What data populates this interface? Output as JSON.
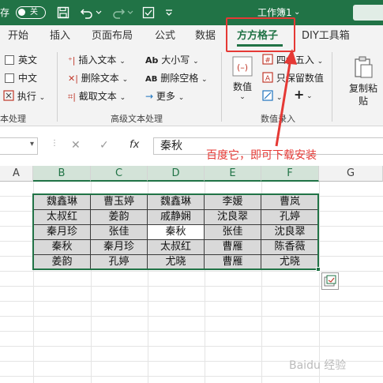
{
  "titlebar": {
    "autosave_label": "存",
    "toggle_label": "关",
    "title": "工作簿1",
    "title_arrow": "⌄"
  },
  "tabs": [
    {
      "label": "开始"
    },
    {
      "label": "插入"
    },
    {
      "label": "页面布局"
    },
    {
      "label": "公式"
    },
    {
      "label": "数据"
    },
    {
      "label": "方方格子",
      "active": true
    },
    {
      "label": "DIY工具箱"
    }
  ],
  "ribbon": {
    "text_group": {
      "items": [
        "英文",
        "中文",
        "执行"
      ],
      "label": "本处理"
    },
    "adv_text": {
      "col1": [
        "插入文本",
        "删除文本",
        "截取文本"
      ],
      "col2": [
        "大小写",
        "删除空格",
        "更多"
      ],
      "col2_icons": [
        "Ab",
        "AB",
        "→"
      ],
      "label": "高级文本处理"
    },
    "numeric": {
      "big_button": "数值",
      "items": [
        "四舍五入",
        "只保留数值"
      ],
      "label": "数值录入"
    },
    "copy": {
      "label_line1": "复制粘",
      "label_line2": "贴"
    }
  },
  "formula_bar": {
    "cancel": "✕",
    "confirm": "✓",
    "fx": "fx",
    "value": "秦秋"
  },
  "columns": [
    "A",
    "B",
    "C",
    "D",
    "E",
    "F",
    "G"
  ],
  "table": [
    [
      "魏鑫琳",
      "曹玉婷",
      "魏鑫琳",
      "李媛",
      "曹岚"
    ],
    [
      "太叔红",
      "姜韵",
      "戚静娴",
      "沈良翠",
      "孔婷"
    ],
    [
      "秦月珍",
      "张佳",
      "秦秋",
      "张佳",
      "沈良翠"
    ],
    [
      "秦秋",
      "秦月珍",
      "太叔红",
      "曹雁",
      "陈香薇"
    ],
    [
      "姜韵",
      "孔婷",
      "尤晓",
      "曹雁",
      "尤晓"
    ]
  ],
  "annotation": {
    "text": "百度它，即可下载安装"
  },
  "watermark": "Baidu 经验",
  "colors": {
    "brand": "#217346",
    "annotation": "#e53935"
  }
}
